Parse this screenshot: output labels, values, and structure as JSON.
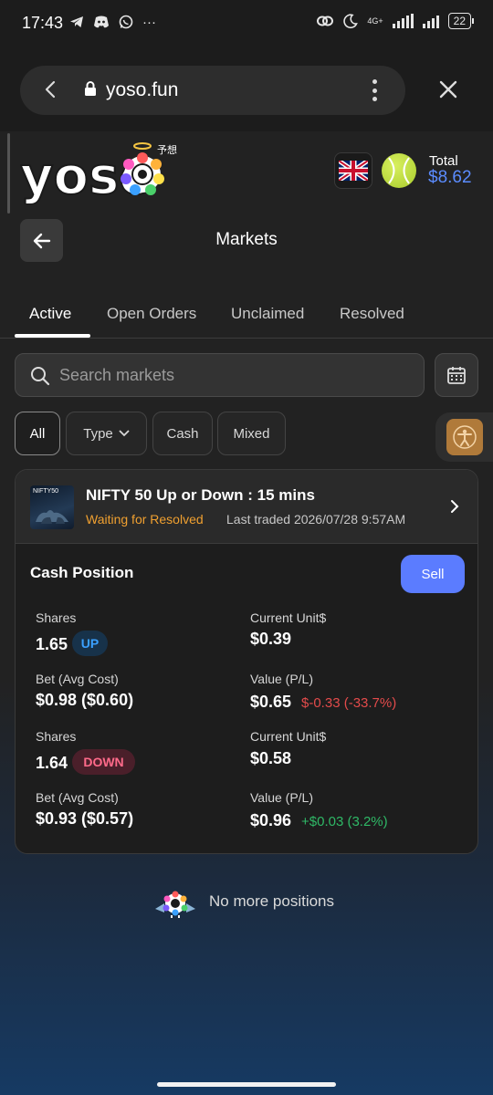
{
  "status_bar": {
    "time": "17:43",
    "net_type": "4G+",
    "battery": "22",
    "more": "···"
  },
  "browser": {
    "url": "yoso.fun"
  },
  "header": {
    "logo_text": "yoso",
    "logo_sub": "予想",
    "total_label": "Total",
    "total_value": "$8.62"
  },
  "page": {
    "title": "Markets"
  },
  "tabs": [
    {
      "label": "Active",
      "active": true
    },
    {
      "label": "Open Orders",
      "active": false
    },
    {
      "label": "Unclaimed",
      "active": false
    },
    {
      "label": "Resolved",
      "active": false
    }
  ],
  "search": {
    "placeholder": "Search markets"
  },
  "filters": [
    {
      "label": "All",
      "active": true
    },
    {
      "label": "Type",
      "dropdown": true
    },
    {
      "label": "Cash"
    },
    {
      "label": "Mixed"
    }
  ],
  "market": {
    "thumb_label": "NIFTY50",
    "title": "NIFTY 50 Up or Down : 15 mins",
    "status": "Waiting for Resolved",
    "last_traded": "Last traded 2026/07/28 9:57AM",
    "position_title": "Cash Position",
    "sell_label": "Sell",
    "positions": [
      {
        "shares_label": "Shares",
        "shares": "1.65",
        "side": "UP",
        "unit_label": "Current Unit$",
        "unit": "$0.39",
        "bet_label": "Bet (Avg Cost)",
        "bet": "$0.98 ($0.60)",
        "value_label": "Value (P/L)",
        "value": "$0.65",
        "pl": "$-0.33 (-33.7%)"
      },
      {
        "shares_label": "Shares",
        "shares": "1.64",
        "side": "DOWN",
        "unit_label": "Current Unit$",
        "unit": "$0.58",
        "bet_label": "Bet (Avg Cost)",
        "bet": "$0.93 ($0.57)",
        "value_label": "Value (P/L)",
        "value": "$0.96",
        "pl": "+$0.03 (3.2%)"
      }
    ]
  },
  "footer": {
    "no_more": "No more positions"
  },
  "colors": {
    "accent": "#5b7cff",
    "total": "#5b8cff",
    "waiting": "#f0a030",
    "loss": "#e34b4b",
    "gain": "#2fb866",
    "up": "#3aa0ff",
    "down": "#ff6a8a"
  },
  "icons": [
    "telegram-icon",
    "discord-icon",
    "whatsapp-icon",
    "link-icon",
    "moon-icon",
    "signal-icon",
    "battery-icon",
    "back-chevron-icon",
    "lock-icon",
    "kebab-menu-icon",
    "close-icon",
    "uk-flag-icon",
    "tennis-ball-icon",
    "arrow-left-icon",
    "search-icon",
    "calendar-icon",
    "chevron-down-icon",
    "accessibility-icon",
    "chevron-right-icon",
    "mascot-icon"
  ]
}
